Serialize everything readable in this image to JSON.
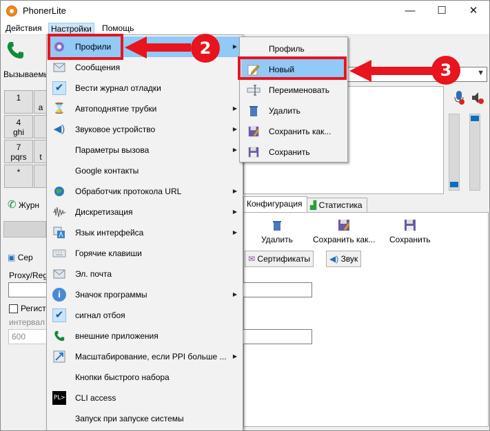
{
  "window": {
    "title": "PhonerLite",
    "controls": {
      "minimize": "—",
      "maximize": "☐",
      "close": "✕"
    }
  },
  "menubar": {
    "items": [
      "Действия",
      "Настройки",
      "Помощь"
    ],
    "active": "Настройки"
  },
  "main": {
    "callee_label": "Вызываемь",
    "keypad": [
      {
        "digit": "1",
        "letters": ""
      },
      {
        "digit": "a",
        "letters": ""
      },
      {
        "digit": "4",
        "letters": "ghi"
      },
      {
        "digit": "7",
        "letters": "pqrs"
      },
      {
        "digit": "t",
        "letters": ""
      },
      {
        "digit": "*",
        "letters": ""
      }
    ],
    "journal_tab": "Журн",
    "left_tab2": "Сер",
    "proxy_label": "Proxy/Reg",
    "register_label": "Регистр",
    "interval_label": "интервал",
    "interval_value": "600"
  },
  "config_tabs": [
    "Конфигурация",
    "Статистика"
  ],
  "toolbar": {
    "delete": "Удалить",
    "save_as": "Сохранить как...",
    "save": "Сохранить"
  },
  "subtabs": [
    "Сертификаты",
    "Звук"
  ],
  "menu": {
    "items": [
      {
        "label": "Профили",
        "icon": "gear-icon",
        "submenu": true
      },
      {
        "label": "Сообщения",
        "icon": "envelope-icon",
        "submenu": false
      },
      {
        "label": "Вести журнал отладки",
        "icon": "check-icon",
        "submenu": false
      },
      {
        "label": "Автоподнятие трубки",
        "icon": "hourglass-phone-icon",
        "submenu": true
      },
      {
        "label": "Звуковое устройство",
        "icon": "speaker-icon",
        "submenu": true
      },
      {
        "label": "Параметры вызова",
        "icon": "",
        "submenu": true
      },
      {
        "label": "Google контакты",
        "icon": "",
        "submenu": false
      },
      {
        "label": "Обработчик протокола URL",
        "icon": "globe-icon",
        "submenu": true
      },
      {
        "label": "Дискретизация",
        "icon": "waveform-icon",
        "submenu": true
      },
      {
        "label": "Язык интерфейса",
        "icon": "language-icon",
        "submenu": true
      },
      {
        "label": "Горячие клавиши",
        "icon": "keyboard-icon",
        "submenu": false
      },
      {
        "label": "Эл. почта",
        "icon": "mail-icon",
        "submenu": false
      },
      {
        "label": "Значок программы",
        "icon": "info-icon",
        "submenu": true
      },
      {
        "label": "сигнал отбоя",
        "icon": "check-icon",
        "submenu": false
      },
      {
        "label": "внешние приложения",
        "icon": "phone-icon",
        "submenu": false
      },
      {
        "label": "Масштабирование, если PPI больше ...",
        "icon": "scale-icon",
        "submenu": true
      },
      {
        "label": "Кнопки быстрого набора",
        "icon": "",
        "submenu": false
      },
      {
        "label": "CLI access",
        "icon": "cli-icon",
        "submenu": false
      },
      {
        "label": "Запуск при запуске системы",
        "icon": "",
        "submenu": false
      }
    ]
  },
  "submenu": {
    "items": [
      {
        "label": "Профиль",
        "icon": ""
      },
      {
        "label": "Новый",
        "icon": "pencil-icon"
      },
      {
        "label": "Переименовать",
        "icon": "rename-icon"
      },
      {
        "label": "Удалить",
        "icon": "trash-icon"
      },
      {
        "label": "Сохранить как...",
        "icon": "save-as-icon"
      },
      {
        "label": "Сохранить",
        "icon": "floppy-icon"
      }
    ]
  },
  "annotations": {
    "step2": "2",
    "step3": "3"
  },
  "colors": {
    "highlight": "#91c9f7",
    "annotation_red": "#e8141e",
    "accent_green": "#138a3c",
    "accent_blue": "#0a6fc2"
  }
}
